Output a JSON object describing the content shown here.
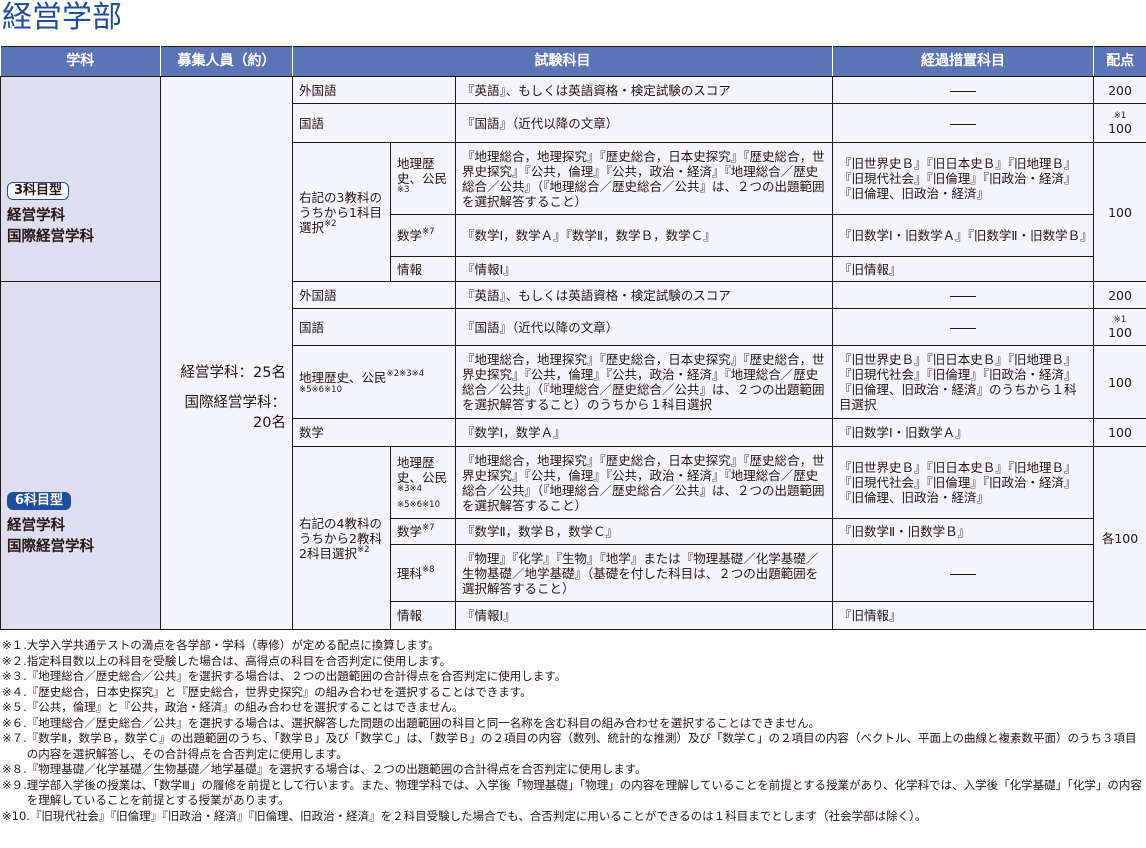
{
  "title": "経営学部",
  "header": {
    "department": "学科",
    "capacity": "募集人員（約）",
    "subjects": "試験科目",
    "transition": "経過措置科目",
    "points": "配点"
  },
  "capacity": {
    "line1": "経営学科：25名",
    "line2": "国際経営学科：",
    "line3": "20名"
  },
  "dash": "——",
  "type3": {
    "badge": "3科目型",
    "departments": [
      "経営学科",
      "国際経営学科"
    ],
    "rows": [
      {
        "area": "外国語",
        "subjects": "『英語』、もしくは英語資格・検定試験のスコア",
        "transition": "——",
        "points": "200"
      },
      {
        "area": "国語",
        "subjects": "『国語』（近代以降の文章）",
        "transition": "——",
        "points_note": "※1",
        "points": "100"
      }
    ],
    "choice": {
      "label": "右記の3教科のうちから1科目選択",
      "label_note": "※2",
      "points": "100",
      "items": [
        {
          "area": "地理歴史、公民",
          "note": "※3",
          "subjects": "『地理総合，地理探究』『歴史総合，日本史探究』『歴史総合，世界史探究』『公共，倫理』『公共，政治・経済』『地理総合／歴史総合／公共』（『地理総合／歴史総合／公共』は、２つの出題範囲を選択解答すること）",
          "transition": "『旧世界史Ｂ』『旧日本史Ｂ』『旧地理Ｂ』『旧現代社会』『旧倫理』『旧政治・経済』『旧倫理、旧政治・経済』"
        },
        {
          "area": "数学",
          "note": "※7",
          "subjects": "『数学Ⅰ，数学Ａ』『数学Ⅱ，数学Ｂ，数学Ｃ』",
          "transition": "『旧数学Ⅰ・旧数学Ａ』『旧数学Ⅱ・旧数学Ｂ』"
        },
        {
          "area": "情報",
          "note": "",
          "subjects": "『情報Ⅰ』",
          "transition": "『旧情報』"
        }
      ]
    }
  },
  "type6": {
    "badge": "6科目型",
    "departments": [
      "経営学科",
      "国際経営学科"
    ],
    "rows": [
      {
        "area": "外国語",
        "note": "",
        "subjects": "『英語』、もしくは英語資格・検定試験のスコア",
        "transition": "——",
        "points": "200"
      },
      {
        "area": "国語",
        "note": "",
        "subjects": "『国語』（近代以降の文章）",
        "transition": "——",
        "points_note": "※1",
        "points": "100"
      },
      {
        "area": "地理歴史、公民",
        "note": "※2※3※4",
        "note2": "※5※6※10",
        "subjects": "『地理総合，地理探究』『歴史総合，日本史探究』『歴史総合，世界史探究』『公共，倫理』『公共，政治・経済』『地理総合／歴史総合／公共』（『地理総合／歴史総合／公共』は、２つの出題範囲を選択解答すること）のうちから１科目選択",
        "transition": "『旧世界史Ｂ』『旧日本史Ｂ』『旧地理Ｂ』『旧現代社会』『旧倫理』『旧政治・経済』『旧倫理、旧政治・経済』のうちから１科目選択",
        "points": "100"
      },
      {
        "area": "数学",
        "note": "",
        "subjects": "『数学Ⅰ，数学Ａ』",
        "transition": "『旧数学Ⅰ・旧数学Ａ』",
        "points": "100"
      }
    ],
    "choice": {
      "label": "右記の4教科のうちから2教科2科目選択",
      "label_note": "※2",
      "points": "各100",
      "items": [
        {
          "area": "地理歴史、公民",
          "note": "※3※4",
          "note2": "※5※6※10",
          "subjects": "『地理総合，地理探究』『歴史総合，日本史探究』『歴史総合，世界史探究』『公共，倫理』『公共，政治・経済』『地理総合／歴史総合／公共』（『地理総合／歴史総合／公共』は、２つの出題範囲を選択解答すること）",
          "transition": "『旧世界史Ｂ』『旧日本史Ｂ』『旧地理Ｂ』『旧現代社会』『旧倫理』『旧政治・経済』『旧倫理、旧政治・経済』"
        },
        {
          "area": "数学",
          "note": "※7",
          "subjects": "『数学Ⅱ，数学Ｂ，数学Ｃ』",
          "transition": "『旧数学Ⅱ・旧数学Ｂ』"
        },
        {
          "area": "理科",
          "note": "※8",
          "subjects": "『物理』『化学』『生物』『地学』または『物理基礎／化学基礎／生物基礎／地学基礎』（基礎を付した科目は、２つの出題範囲を選択解答すること）",
          "transition": "——"
        },
        {
          "area": "情報",
          "note": "",
          "subjects": "『情報Ⅰ』",
          "transition": "『旧情報』"
        }
      ]
    }
  },
  "footnotes": [
    {
      "mark": "※１.",
      "text": "大学入学共通テストの満点を各学部・学科（専修）が定める配点に換算します。"
    },
    {
      "mark": "※２.",
      "text": "指定科目数以上の科目を受験した場合は、高得点の科目を合否判定に使用します。"
    },
    {
      "mark": "※３.",
      "text": "『地理総合／歴史総合／公共』を選択する場合は、２つの出題範囲の合計得点を合否判定に使用します。"
    },
    {
      "mark": "※４.",
      "text": "『歴史総合，日本史探究』と『歴史総合，世界史探究』の組み合わせを選択することはできます。"
    },
    {
      "mark": "※５.",
      "text": "『公共，倫理』と『公共，政治・経済』の組み合わせを選択することはできません。"
    },
    {
      "mark": "※６.",
      "text": "『地理総合／歴史総合／公共』を選択する場合は、選択解答した問題の出題範囲の科目と同一名称を含む科目の組み合わせを選択することはできません。"
    },
    {
      "mark": "※７.",
      "text": "『数学Ⅱ，数学Ｂ，数学Ｃ』の出題範囲のうち、「数学Ｂ」及び「数学Ｃ」は、「数学Ｂ」の２項目の内容（数列、統計的な推測）及び「数学Ｃ」の２項目の内容（ベクトル、平面上の曲線と複素数平面）のうち３項目の内容を選択解答し、その合計得点を合否判定に使用します。"
    },
    {
      "mark": "※８.",
      "text": "『物理基礎／化学基礎／生物基礎／地学基礎』を選択する場合は、２つの出題範囲の合計得点を合否判定に使用します。"
    },
    {
      "mark": "※９.",
      "text": "理学部入学後の授業は、「数学Ⅲ」の履修を前提として行います。また、物理学科では、入学後「物理基礎」「物理」の内容を理解していることを前提とする授業があり、化学科では、入学後「化学基礎」「化学」の内容を理解していることを前提とする授業があります。"
    },
    {
      "mark": "※10.",
      "text": "『旧現代社会』『旧倫理』『旧政治・経済』『旧倫理、旧政治・経済』を２科目受験した場合でも、合否判定に用いることができるのは１科目までとします（社会学部は除く）。"
    }
  ]
}
